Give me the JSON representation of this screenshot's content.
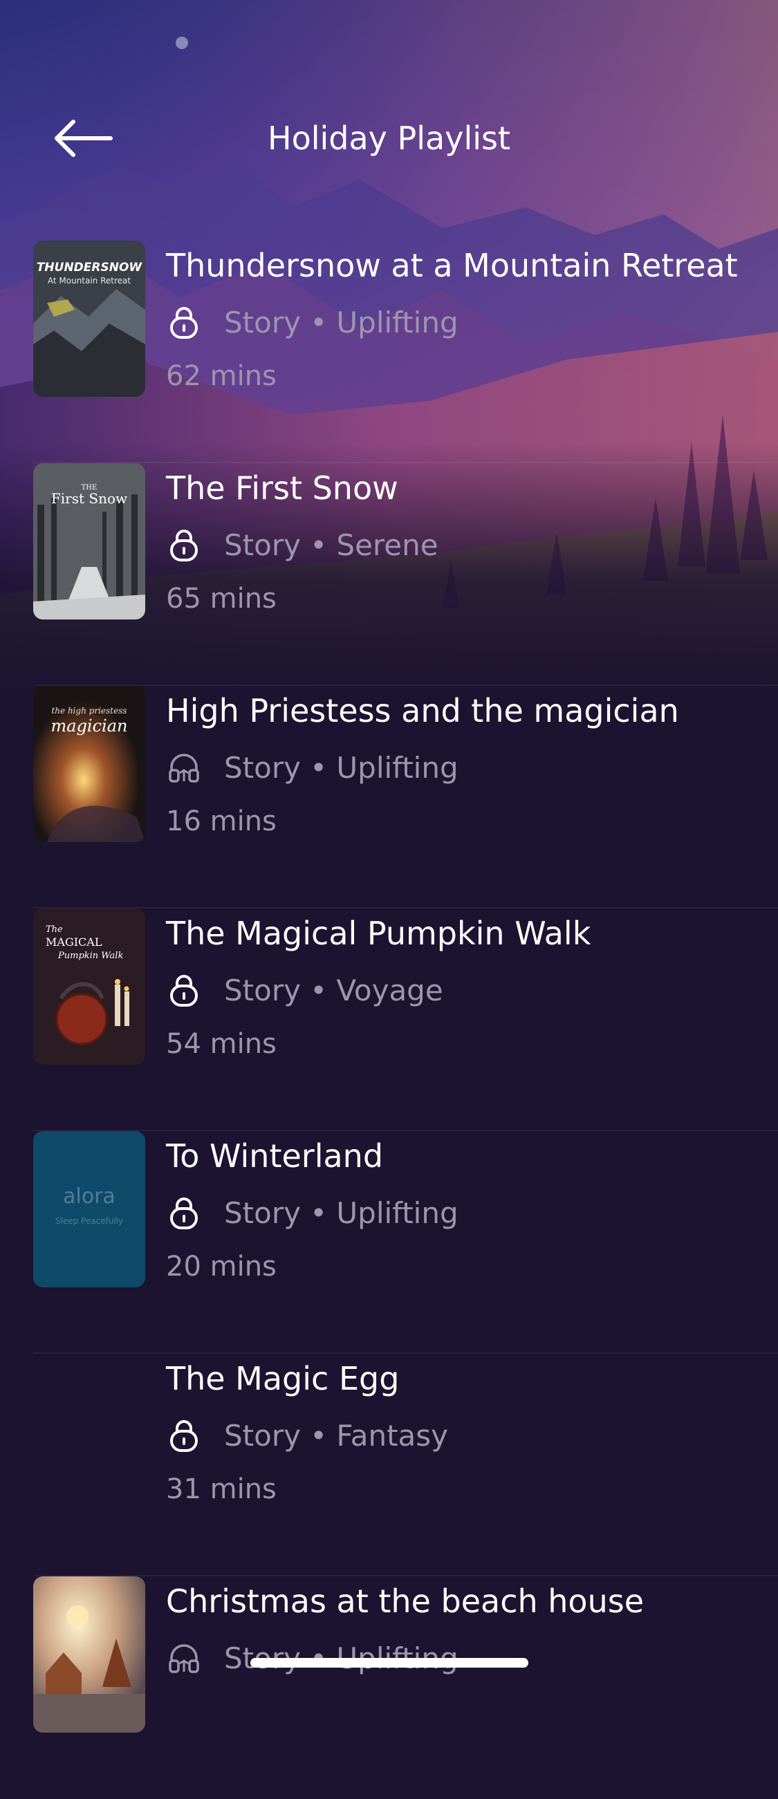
{
  "header": {
    "title": "Holiday Playlist",
    "back_icon": "arrow-left-icon"
  },
  "items": [
    {
      "title": "Thundersnow at a Mountain Retreat",
      "meta": "Story • Uplifting",
      "duration": "62 mins",
      "status_icon": "lock-icon",
      "cover": {
        "line1": "THUNDERSNOW",
        "line2": "At Mountain Retreat"
      }
    },
    {
      "title": "The First Snow",
      "meta": "Story • Serene",
      "duration": "65 mins",
      "status_icon": "lock-icon",
      "cover": {
        "line1": "THE",
        "line2": "First Snow"
      }
    },
    {
      "title": "High Priestess and the magician",
      "meta": "Story • Uplifting",
      "duration": "16 mins",
      "status_icon": "headphones-icon",
      "cover": {
        "line1": "the high priestess",
        "line2": "magician"
      }
    },
    {
      "title": "The Magical Pumpkin Walk",
      "meta": "Story • Voyage",
      "duration": "54 mins",
      "status_icon": "lock-icon",
      "cover": {
        "line1": "The",
        "line2": "MAGICAL",
        "line3": "Pumpkin Walk"
      }
    },
    {
      "title": "To Winterland",
      "meta": "Story • Uplifting",
      "duration": "20 mins",
      "status_icon": "lock-icon",
      "cover": {
        "brand": "alora",
        "tagline": "Sleep Peacefully"
      }
    },
    {
      "title": "The Magic Egg",
      "meta": "Story • Fantasy",
      "duration": "31 mins",
      "status_icon": "lock-icon"
    },
    {
      "title": "Christmas at the beach house",
      "meta": "Story • Uplifting",
      "duration": "",
      "status_icon": "headphones-icon"
    }
  ],
  "colors": {
    "background": "#1b1330",
    "secondary_text": "#9c96ad"
  }
}
